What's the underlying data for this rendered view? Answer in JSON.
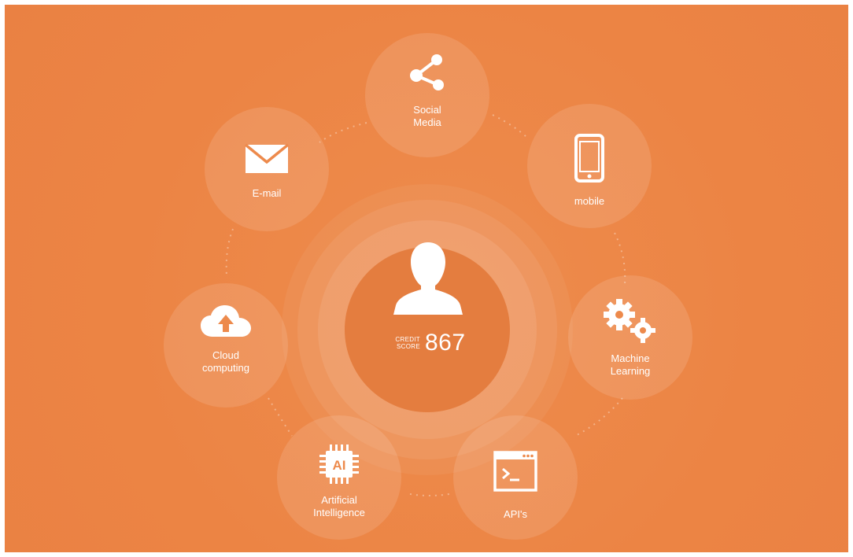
{
  "diagram": {
    "center": {
      "icon": "user-icon",
      "score_label": "CREDIT SCORE",
      "score_value": "867"
    },
    "nodes": [
      {
        "id": "social-media",
        "label": "Social\nMedia",
        "icon": "share-icon"
      },
      {
        "id": "mobile",
        "label": "mobile",
        "icon": "smartphone-icon"
      },
      {
        "id": "machine-learning",
        "label": "Machine\nLearning",
        "icon": "gears-icon"
      },
      {
        "id": "apis",
        "label": "API's",
        "icon": "terminal-window-icon"
      },
      {
        "id": "artificial-intelligence",
        "label": "Artificial\nIntelligence",
        "icon": "ai-chip-icon"
      },
      {
        "id": "cloud-computing",
        "label": "Cloud\ncomputing",
        "icon": "cloud-upload-icon"
      },
      {
        "id": "email",
        "label": "E-mail",
        "icon": "envelope-icon"
      }
    ],
    "colors": {
      "background": "#ec8444",
      "foreground": "#ffffff"
    }
  }
}
